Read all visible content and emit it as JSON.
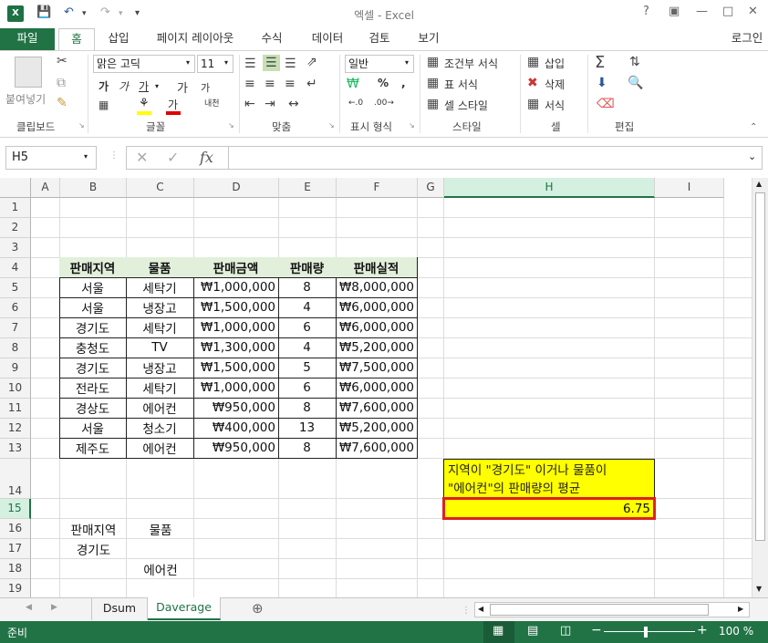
{
  "window": {
    "title": "엑셀 - Excel",
    "signin": "로그인",
    "help_icon": "?"
  },
  "tabs": [
    "파일",
    "홈",
    "삽입",
    "페이지 레이아웃",
    "수식",
    "데이터",
    "검토",
    "보기"
  ],
  "ribbon": {
    "clipboard": {
      "paste": "붙여넣기",
      "label": "클립보드"
    },
    "font": {
      "name": "맑은 고딕",
      "size": "11",
      "label": "글꼴",
      "bold": "가",
      "italic": "가",
      "underline": "가",
      "grow": "가",
      "shrink": "가",
      "phonetic": "내천"
    },
    "align": {
      "label": "맞춤"
    },
    "number": {
      "format": "일반",
      "label": "표시 형식"
    },
    "styles": {
      "cond": "조건부 서식",
      "table": "표 서식",
      "cell": "셀 스타일",
      "label": "스타일"
    },
    "cells": {
      "insert": "삽입",
      "delete": "삭제",
      "format": "서식",
      "label": "셀"
    },
    "editing": {
      "label": "편집"
    }
  },
  "formula_bar": {
    "name_box": "H5",
    "fx": "fx",
    "value": ""
  },
  "columns": [
    "A",
    "B",
    "C",
    "D",
    "E",
    "F",
    "G",
    "H",
    "I"
  ],
  "rows": [
    "1",
    "2",
    "3",
    "4",
    "5",
    "6",
    "7",
    "8",
    "9",
    "10",
    "11",
    "12",
    "13",
    "14",
    "15",
    "16",
    "17",
    "18",
    "19"
  ],
  "table": {
    "headers": [
      "판매지역",
      "물품",
      "판매금액",
      "판매량",
      "판매실적"
    ],
    "rows": [
      [
        "서울",
        "세탁기",
        "₩1,000,000",
        "8",
        "₩8,000,000"
      ],
      [
        "서울",
        "냉장고",
        "₩1,500,000",
        "4",
        "₩6,000,000"
      ],
      [
        "경기도",
        "세탁기",
        "₩1,000,000",
        "6",
        "₩6,000,000"
      ],
      [
        "충청도",
        "TV",
        "₩1,300,000",
        "4",
        "₩5,200,000"
      ],
      [
        "경기도",
        "냉장고",
        "₩1,500,000",
        "5",
        "₩7,500,000"
      ],
      [
        "전라도",
        "세탁기",
        "₩1,000,000",
        "6",
        "₩6,000,000"
      ],
      [
        "경상도",
        "에어컨",
        "₩950,000",
        "8",
        "₩7,600,000"
      ],
      [
        "서울",
        "청소기",
        "₩400,000",
        "13",
        "₩5,200,000"
      ],
      [
        "제주도",
        "에어컨",
        "₩950,000",
        "8",
        "₩7,600,000"
      ]
    ]
  },
  "criteria": {
    "h1": "판매지역",
    "h2": "물품",
    "v1": "경기도",
    "v2": "에어컨"
  },
  "note": {
    "line1": "지역이 \"경기도\" 이거나 물품이",
    "line2": "\"에어컨\"의 판매량의 평균",
    "result": "6.75"
  },
  "sheets": [
    "Dsum",
    "Daverage"
  ],
  "status": {
    "ready": "준비",
    "zoom": "100 %"
  }
}
